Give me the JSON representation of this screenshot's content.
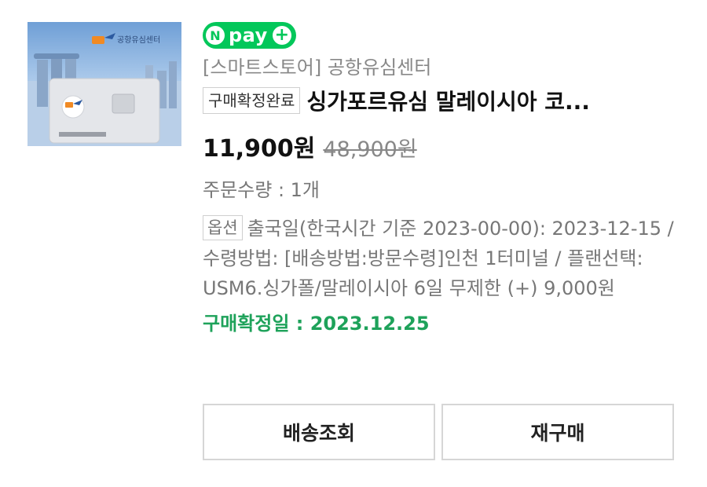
{
  "thumbnail": {
    "brand_text": "공항유심센터"
  },
  "payment_badge": {
    "n": "N",
    "label": "pay",
    "plus": "+"
  },
  "store_name": "[스마트스토어] 공항유심센터",
  "status_badge": "구매확정완료",
  "product_title": "싱가포르유심 말레이시아 코...",
  "price": {
    "sale": "11,900원",
    "original": "48,900원"
  },
  "quantity": "주문수량 : 1개",
  "option": {
    "badge": "옵션",
    "text": "출국일(한국시간 기준 2023-00-00): 2023-12-15 / 수령방법: [배송방법:방문수령]인천 1터미널 / 플랜선택: USM6.싱가폴/말레이시아 6일 무제한 (+) 9,000원"
  },
  "confirm_date": "구매확정일 : 2023.12.25",
  "buttons": {
    "track": "배송조회",
    "reorder": "재구매"
  },
  "colors": {
    "npay_green": "#03c75a",
    "confirm_green": "#1ea25a"
  }
}
